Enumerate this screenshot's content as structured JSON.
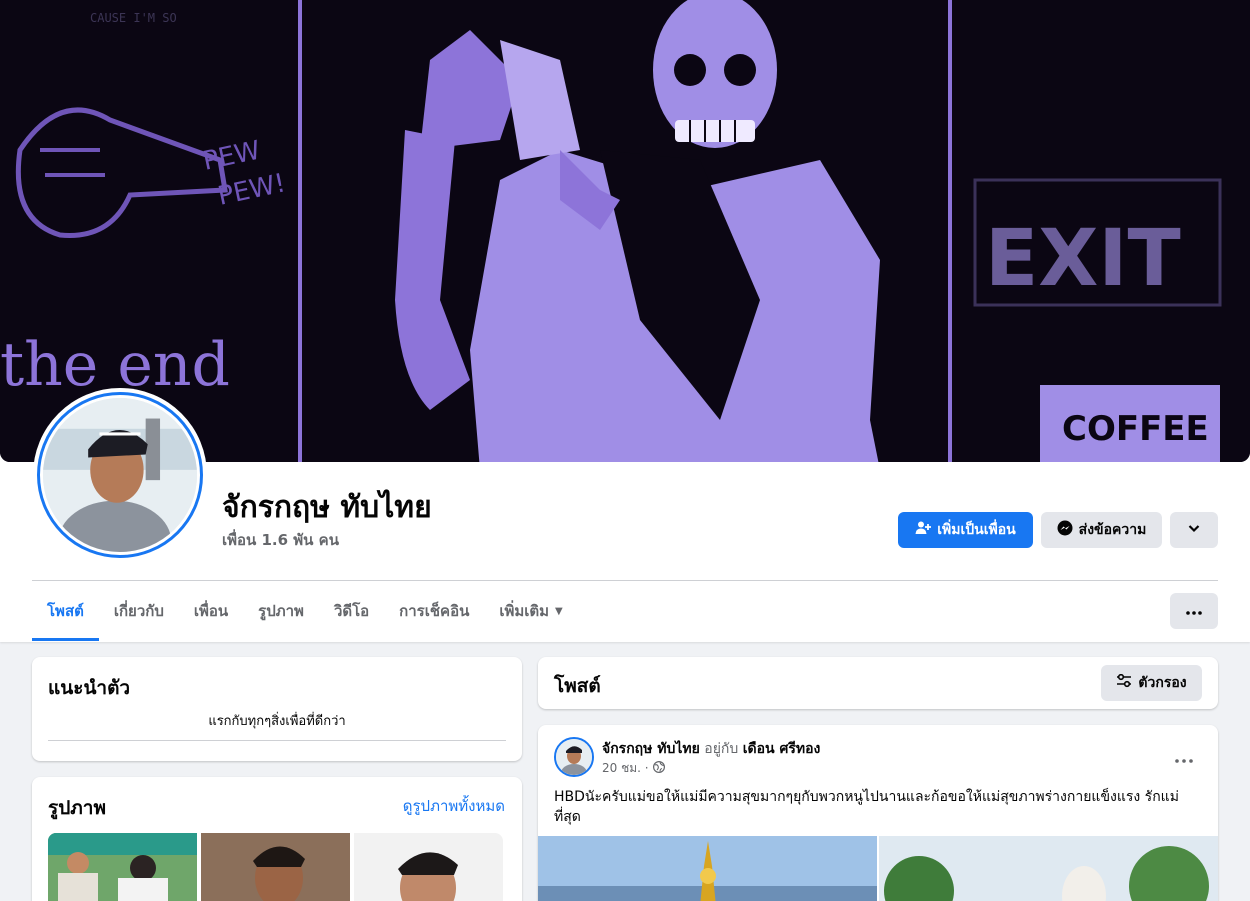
{
  "profile": {
    "name": "จักรกฤษ ทับไทย",
    "friends": "เพื่อน 1.6 พัน คน"
  },
  "actions": {
    "add_friend": "เพิ่มเป็นเพื่อน",
    "message": "ส่งข้อความ"
  },
  "tabs": [
    {
      "label": "โพสต์",
      "active": true
    },
    {
      "label": "เกี่ยวกับ"
    },
    {
      "label": "เพื่อน"
    },
    {
      "label": "รูปภาพ"
    },
    {
      "label": "วิดีโอ"
    },
    {
      "label": "การเช็คอิน"
    },
    {
      "label": "เพิ่มเติม"
    }
  ],
  "intro": {
    "title": "แนะนำตัว",
    "bio": "แรกกับทุกๆสิ่งเพื่อที่ดีกว่า"
  },
  "photos": {
    "title": "รูปภาพ",
    "see_all": "ดูรูปภาพทั้งหมด"
  },
  "posts_section": {
    "title": "โพสต์",
    "filter": "ตัวกรอง"
  },
  "post": {
    "author": "จักรกฤษ ทับไทย",
    "with_word": "อยู่กับ",
    "tagged": "เดือน ศรีทอง",
    "time": "20 ชม. ·",
    "text": "HBDนัะครับแม่ขอให้แม่มีความสุขมากๆยุกับพวกหนูไปนานและก้อขอให้แม่สุขภาพร่างกายแข็งแรง รักแม่ที่สุด"
  },
  "cover_texts": {
    "t1": "PEW",
    "t2": "PEW!",
    "t3": "the end",
    "t4": "EXIT",
    "t5": "COFFEE"
  },
  "colors": {
    "brand": "#1877f2",
    "cover_purple": "#8d74d9",
    "cover_bg": "#0b0613"
  }
}
